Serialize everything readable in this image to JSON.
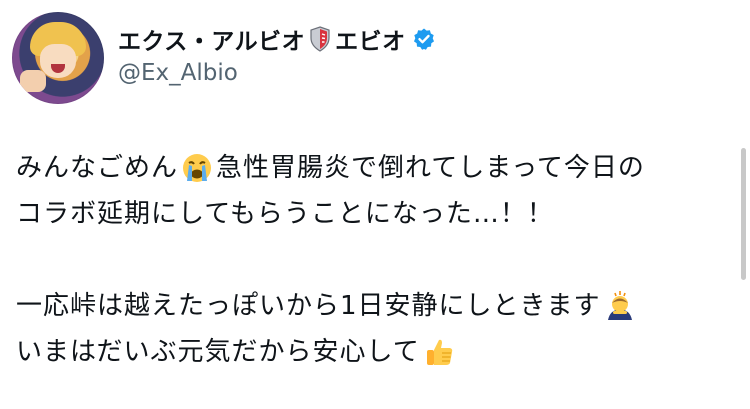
{
  "author": {
    "display_name_part1": "エクス・アルビオ",
    "display_name_part2": "エビオ",
    "handle": "@Ex_Albio",
    "verified_color": "#1d9bf0"
  },
  "tweet": {
    "line1_a": "みんなごめん",
    "line1_b": "急性胃腸炎で倒れてしまって今日の",
    "line2": "コラボ延期にしてもらうことになった…！！",
    "line3": "一応峠は越えたっぽいから1日安静にしときます",
    "line4": "いまはだいぶ元気だから安心して",
    "emojis": [
      "loudly-crying-face",
      "person-bowing",
      "thumbs-up"
    ]
  }
}
